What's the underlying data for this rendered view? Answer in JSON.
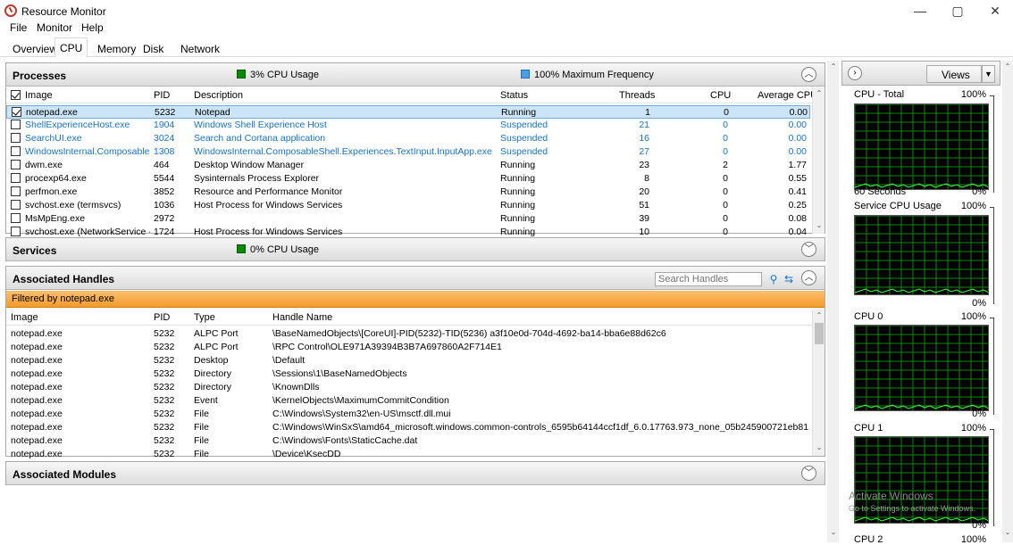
{
  "window": {
    "title": "Resource Monitor",
    "minimize": "—",
    "maximize": "▢",
    "close": "✕"
  },
  "menu": [
    "File",
    "Monitor",
    "Help"
  ],
  "tabs": [
    "Overview",
    "CPU",
    "Memory",
    "Disk",
    "Network"
  ],
  "active_tab": "CPU",
  "processes": {
    "title": "Processes",
    "cpu_usage": "3% CPU Usage",
    "max_freq": "100% Maximum Frequency",
    "columns": [
      "Image",
      "PID",
      "Description",
      "Status",
      "Threads",
      "CPU",
      "Average CPU"
    ],
    "rows": [
      {
        "image": "notepad.exe",
        "pid": "5232",
        "desc": "Notepad",
        "status": "Running",
        "threads": "1",
        "cpu": "0",
        "avg": "0.00",
        "checked": true,
        "selected": true,
        "suspended": false
      },
      {
        "image": "ShellExperienceHost.exe",
        "pid": "1904",
        "desc": "Windows Shell Experience Host",
        "status": "Suspended",
        "threads": "21",
        "cpu": "0",
        "avg": "0.00",
        "checked": false,
        "selected": false,
        "suspended": true
      },
      {
        "image": "SearchUI.exe",
        "pid": "3024",
        "desc": "Search and Cortana application",
        "status": "Suspended",
        "threads": "16",
        "cpu": "0",
        "avg": "0.00",
        "checked": false,
        "selected": false,
        "suspended": true
      },
      {
        "image": "WindowsInternal.ComposableS...",
        "pid": "1308",
        "desc": "WindowsInternal.ComposableShell.Experiences.TextInput.InputApp.exe",
        "status": "Suspended",
        "threads": "27",
        "cpu": "0",
        "avg": "0.00",
        "checked": false,
        "selected": false,
        "suspended": true
      },
      {
        "image": "dwm.exe",
        "pid": "464",
        "desc": "Desktop Window Manager",
        "status": "Running",
        "threads": "23",
        "cpu": "2",
        "avg": "1.77",
        "checked": false,
        "selected": false,
        "suspended": false
      },
      {
        "image": "procexp64.exe",
        "pid": "5544",
        "desc": "Sysinternals Process Explorer",
        "status": "Running",
        "threads": "8",
        "cpu": "0",
        "avg": "0.55",
        "checked": false,
        "selected": false,
        "suspended": false
      },
      {
        "image": "perfmon.exe",
        "pid": "3852",
        "desc": "Resource and Performance Monitor",
        "status": "Running",
        "threads": "20",
        "cpu": "0",
        "avg": "0.41",
        "checked": false,
        "selected": false,
        "suspended": false
      },
      {
        "image": "svchost.exe (termsvcs)",
        "pid": "1036",
        "desc": "Host Process for Windows Services",
        "status": "Running",
        "threads": "51",
        "cpu": "0",
        "avg": "0.25",
        "checked": false,
        "selected": false,
        "suspended": false
      },
      {
        "image": "MsMpEng.exe",
        "pid": "2972",
        "desc": "",
        "status": "Running",
        "threads": "39",
        "cpu": "0",
        "avg": "0.08",
        "checked": false,
        "selected": false,
        "suspended": false
      },
      {
        "image": "svchost.exe (NetworkService -p)",
        "pid": "1724",
        "desc": "Host Process for Windows Services",
        "status": "Running",
        "threads": "10",
        "cpu": "0",
        "avg": "0.04",
        "checked": false,
        "selected": false,
        "suspended": false
      }
    ]
  },
  "services": {
    "title": "Services",
    "cpu_usage": "0% CPU Usage"
  },
  "handles": {
    "title": "Associated Handles",
    "search_placeholder": "Search Handles",
    "filter": "Filtered by notepad.exe",
    "columns": [
      "Image",
      "PID",
      "Type",
      "Handle Name"
    ],
    "rows": [
      {
        "image": "notepad.exe",
        "pid": "5232",
        "type": "ALPC Port",
        "name": "\\BaseNamedObjects\\[CoreUI]-PID(5232)-TID(5236) a3f10e0d-704d-4692-ba14-bba6e88d62c6"
      },
      {
        "image": "notepad.exe",
        "pid": "5232",
        "type": "ALPC Port",
        "name": "\\RPC Control\\OLE971A39394B3B7A697860A2F714E1"
      },
      {
        "image": "notepad.exe",
        "pid": "5232",
        "type": "Desktop",
        "name": "\\Default"
      },
      {
        "image": "notepad.exe",
        "pid": "5232",
        "type": "Directory",
        "name": "\\Sessions\\1\\BaseNamedObjects"
      },
      {
        "image": "notepad.exe",
        "pid": "5232",
        "type": "Directory",
        "name": "\\KnownDlls"
      },
      {
        "image": "notepad.exe",
        "pid": "5232",
        "type": "Event",
        "name": "\\KernelObjects\\MaximumCommitCondition"
      },
      {
        "image": "notepad.exe",
        "pid": "5232",
        "type": "File",
        "name": "C:\\Windows\\System32\\en-US\\msctf.dll.mui"
      },
      {
        "image": "notepad.exe",
        "pid": "5232",
        "type": "File",
        "name": "C:\\Windows\\WinSxS\\amd64_microsoft.windows.common-controls_6595b64144ccf1df_6.0.17763.973_none_05b245900721eb81"
      },
      {
        "image": "notepad.exe",
        "pid": "5232",
        "type": "File",
        "name": "C:\\Windows\\Fonts\\StaticCache.dat"
      },
      {
        "image": "notepad.exe",
        "pid": "5232",
        "type": "File",
        "name": "\\Device\\KsecDD"
      }
    ]
  },
  "modules": {
    "title": "Associated Modules"
  },
  "graphs": {
    "views_label": "Views",
    "items": [
      {
        "title": "CPU - Total",
        "max": "100%",
        "time": "60 Seconds",
        "min": "0%"
      },
      {
        "title": "Service CPU Usage",
        "max": "100%",
        "time": "",
        "min": "0%"
      },
      {
        "title": "CPU 0",
        "max": "100%",
        "time": "",
        "min": "0%"
      },
      {
        "title": "CPU 1",
        "max": "100%",
        "time": "",
        "min": "0%"
      },
      {
        "title": "CPU 2",
        "max": "100%",
        "time": "",
        "min": ""
      }
    ]
  },
  "watermark": {
    "line1": "Activate Windows",
    "line2": "Go to Settings to activate Windows."
  }
}
